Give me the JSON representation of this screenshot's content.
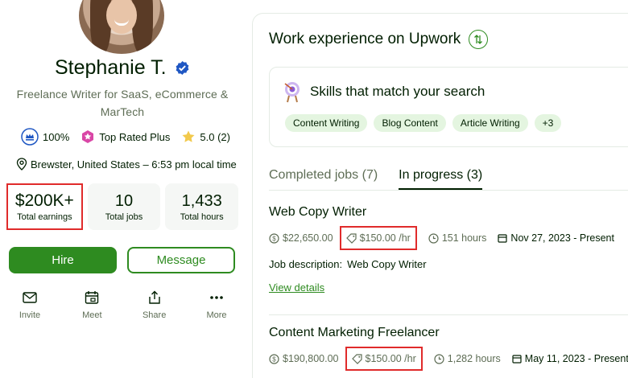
{
  "profile": {
    "name": "Stephanie T.",
    "title": "Freelance Writer for SaaS, eCommerce & MarTech",
    "job_success": "100%",
    "badge": "Top Rated Plus",
    "rating": "5.0 (2)",
    "location": "Brewster, United States – 6:53 pm local time"
  },
  "stats": [
    {
      "value": "$200K+",
      "label": "Total earnings"
    },
    {
      "value": "10",
      "label": "Total jobs"
    },
    {
      "value": "1,433",
      "label": "Total hours"
    }
  ],
  "buttons": {
    "hire": "Hire",
    "message": "Message"
  },
  "actions": [
    {
      "label": "Invite",
      "icon": "mail-icon"
    },
    {
      "label": "Meet",
      "icon": "calendar-icon"
    },
    {
      "label": "Share",
      "icon": "share-icon"
    },
    {
      "label": "More",
      "icon": "more-icon"
    }
  ],
  "work": {
    "title": "Work experience on Upwork",
    "skills_heading": "Skills that match your search",
    "skills": [
      "Content Writing",
      "Blog Content",
      "Article Writing",
      "+3"
    ],
    "tabs": [
      "Completed jobs (7)",
      "In progress (3)"
    ],
    "jobs": [
      {
        "title": "Web Copy Writer",
        "earned": "$22,650.00",
        "rate": "$150.00 /hr",
        "hours": "151 hours",
        "date": "Nov 27, 2023 - Present",
        "desc_key": "Job description:",
        "desc_val": "Web Copy Writer",
        "view": "View details"
      },
      {
        "title": "Content Marketing Freelancer",
        "earned": "$190,800.00",
        "rate": "$150.00 /hr",
        "hours": "1,282 hours",
        "date": "May 11, 2023 - Present"
      }
    ]
  },
  "colors": {
    "accent": "#2e8b20",
    "highlight": "#e02b2b",
    "pill": "#e4f5e0"
  }
}
